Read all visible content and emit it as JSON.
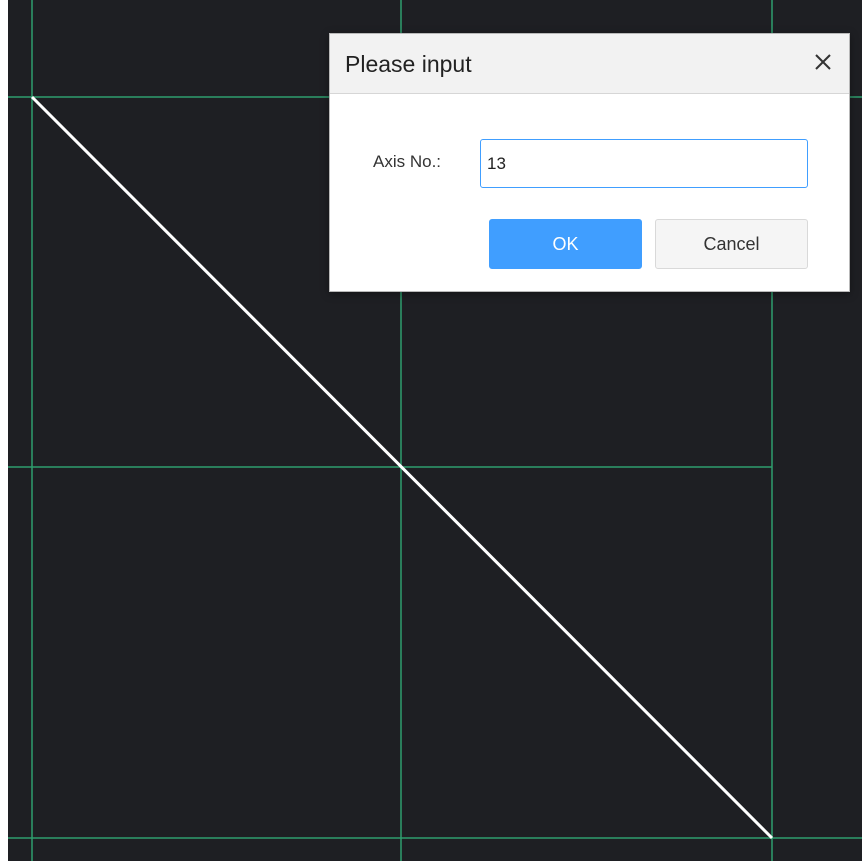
{
  "colors": {
    "canvas_background": "#1e1f23",
    "grid_line": "#2e9e6e",
    "drawn_line": "#ffffff",
    "primary_button": "#409eff",
    "input_focus_border": "#409eff"
  },
  "dialog": {
    "title": "Please input",
    "close_icon": "close-icon",
    "field_label": "Axis No.:",
    "field_value": "13",
    "ok_label": "OK",
    "cancel_label": "Cancel"
  }
}
